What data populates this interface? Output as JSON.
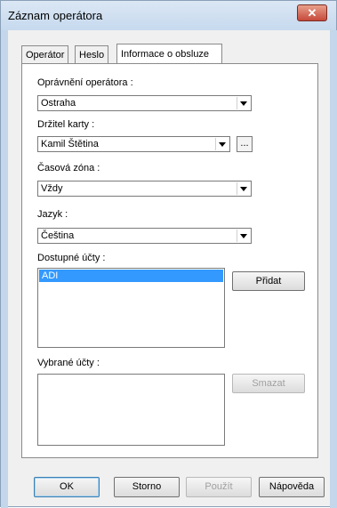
{
  "window": {
    "title": "Záznam operátora",
    "close_glyph": "✕"
  },
  "tabs": [
    {
      "label": "Operátor"
    },
    {
      "label": "Heslo"
    },
    {
      "label": "Informace o obsluze"
    }
  ],
  "form": {
    "permission_label": "Oprávnění operátora :",
    "permission_value": "Ostraha",
    "cardholder_label": "Držitel karty :",
    "cardholder_value": "Kamil Štětina",
    "cardholder_browse": "...",
    "timezone_label": "Časová zóna :",
    "timezone_value": "Vždy",
    "language_label": "Jazyk :",
    "language_value": "Čeština",
    "available_label": "Dostupné účty :",
    "available_items": [
      "ADI"
    ],
    "add_button": "Přidat",
    "selected_label": "Vybrané účty :",
    "delete_button": "Smazat"
  },
  "footer": {
    "ok": "OK",
    "cancel": "Storno",
    "apply": "Použít",
    "help": "Nápověda"
  },
  "icons": {
    "close": "close-icon",
    "dropdown": "chevron-down-icon"
  }
}
